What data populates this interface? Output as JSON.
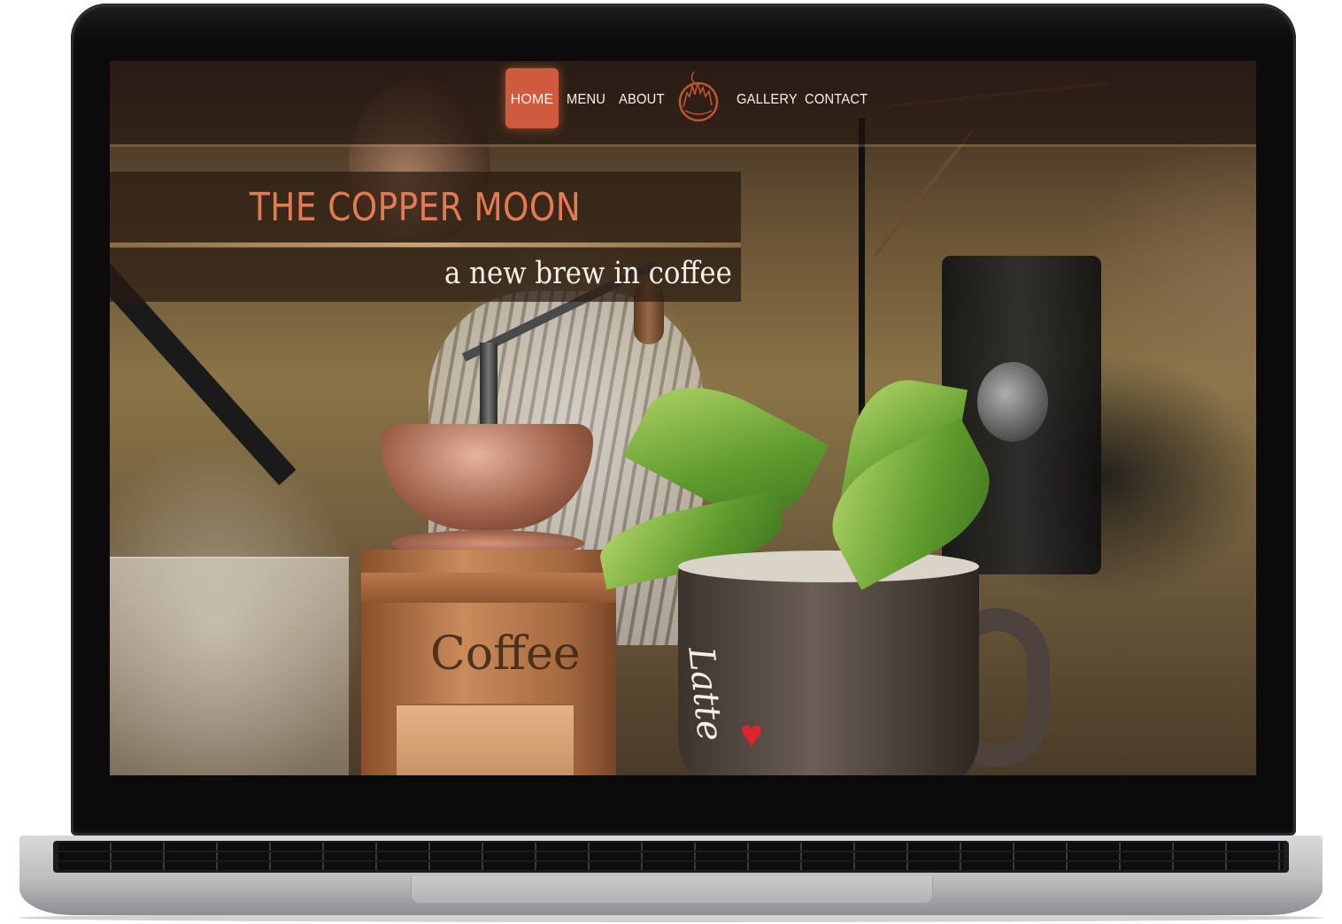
{
  "nav": {
    "items": [
      {
        "label": "HOME",
        "active": true
      },
      {
        "label": "MENU"
      },
      {
        "label": "ABOUT"
      },
      {
        "label": "GALLERY"
      },
      {
        "label": "CONTACT"
      }
    ],
    "logo_icon": "copper-moon-logo-icon",
    "active_color": "#cf5a3d"
  },
  "hero": {
    "title": "THE COPPER MOON",
    "subtitle": "a new brew in coffee",
    "title_color": "#e57a52"
  },
  "photo": {
    "grinder_text": "Coffee",
    "mug_text": "Latte"
  }
}
